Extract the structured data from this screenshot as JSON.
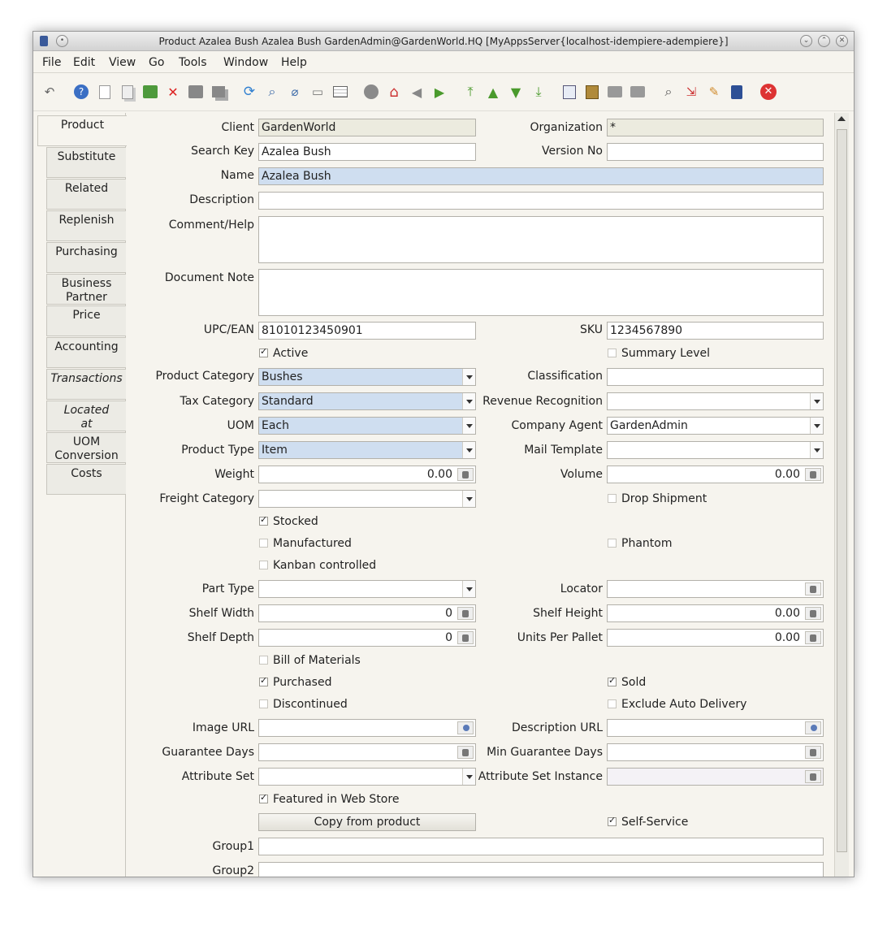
{
  "window": {
    "title": "Product  Azalea Bush  Azalea Bush  GardenAdmin@GardenWorld.HQ [MyAppsServer{localhost-idempiere-adempiere}]"
  },
  "menu": [
    "File",
    "Edit",
    "View",
    "Go",
    "Tools",
    "Window",
    "Help"
  ],
  "toolbar_icons": [
    "undo-icon",
    "help-icon",
    "new-record-icon",
    "copy-record-icon",
    "save-icon",
    "delete-icon",
    "save-grid-icon",
    "multi-record-icon",
    "refresh-icon",
    "find-icon",
    "attachment-icon",
    "chat-icon",
    "grid-toggle-icon",
    "history-icon",
    "home-icon",
    "previous-icon",
    "next-icon",
    "first-record-icon",
    "parent-record-icon",
    "child-record-icon",
    "last-record-icon",
    "report-icon",
    "archive-icon",
    "print-preview-icon",
    "print-icon",
    "zoom-across-icon",
    "workflow-icon",
    "product-info-icon",
    "calculator-icon",
    "close-window-icon"
  ],
  "tabs": [
    {
      "label": "Product",
      "selected": true
    },
    {
      "label": "Substitute"
    },
    {
      "label": "Related"
    },
    {
      "label": "Replenish"
    },
    {
      "label": "Purchasing"
    },
    {
      "label": "Business\nPartner"
    },
    {
      "label": "Price"
    },
    {
      "label": "Accounting"
    },
    {
      "label": "Transactions",
      "italic": true
    },
    {
      "label": "Located\nat",
      "italic": true
    },
    {
      "label": "UOM\nConversion"
    },
    {
      "label": "Costs"
    }
  ],
  "fields": {
    "client": {
      "label": "Client",
      "value": "GardenWorld"
    },
    "organization": {
      "label": "Organization",
      "value": "*"
    },
    "search_key": {
      "label": "Search Key",
      "value": "Azalea Bush"
    },
    "version_no": {
      "label": "Version No",
      "value": ""
    },
    "name": {
      "label": "Name",
      "value": "Azalea Bush"
    },
    "description": {
      "label": "Description",
      "value": ""
    },
    "comment_help": {
      "label": "Comment/Help",
      "value": ""
    },
    "document_note": {
      "label": "Document Note",
      "value": ""
    },
    "upc_ean": {
      "label": "UPC/EAN",
      "value": "81010123450901"
    },
    "sku": {
      "label": "SKU",
      "value": "1234567890"
    },
    "active": {
      "label": "Active",
      "checked": true
    },
    "summary_level": {
      "label": "Summary Level",
      "checked": false
    },
    "product_category": {
      "label": "Product Category",
      "value": "Bushes"
    },
    "classification": {
      "label": "Classification",
      "value": ""
    },
    "tax_category": {
      "label": "Tax Category",
      "value": "Standard"
    },
    "revenue_recognition": {
      "label": "Revenue Recognition",
      "value": ""
    },
    "uom": {
      "label": "UOM",
      "value": "Each"
    },
    "company_agent": {
      "label": "Company Agent",
      "value": "GardenAdmin"
    },
    "product_type": {
      "label": "Product Type",
      "value": "Item"
    },
    "mail_template": {
      "label": "Mail Template",
      "value": ""
    },
    "weight": {
      "label": "Weight",
      "value": "0.00"
    },
    "volume": {
      "label": "Volume",
      "value": "0.00"
    },
    "freight_category": {
      "label": "Freight Category",
      "value": ""
    },
    "drop_shipment": {
      "label": "Drop Shipment",
      "checked": false
    },
    "stocked": {
      "label": "Stocked",
      "checked": true
    },
    "manufactured": {
      "label": "Manufactured",
      "checked": false
    },
    "phantom": {
      "label": "Phantom",
      "checked": false
    },
    "kanban_controlled": {
      "label": "Kanban controlled",
      "checked": false
    },
    "part_type": {
      "label": "Part Type",
      "value": ""
    },
    "locator": {
      "label": "Locator",
      "value": ""
    },
    "shelf_width": {
      "label": "Shelf Width",
      "value": "0"
    },
    "shelf_height": {
      "label": "Shelf Height",
      "value": "0.00"
    },
    "shelf_depth": {
      "label": "Shelf Depth",
      "value": "0"
    },
    "units_per_pallet": {
      "label": "Units Per Pallet",
      "value": "0.00"
    },
    "bill_of_materials": {
      "label": "Bill of Materials",
      "checked": false
    },
    "purchased": {
      "label": "Purchased",
      "checked": true
    },
    "sold": {
      "label": "Sold",
      "checked": true
    },
    "discontinued": {
      "label": "Discontinued",
      "checked": false
    },
    "exclude_auto_delivery": {
      "label": "Exclude Auto Delivery",
      "checked": false
    },
    "image_url": {
      "label": "Image URL",
      "value": ""
    },
    "description_url": {
      "label": "Description URL",
      "value": ""
    },
    "guarantee_days": {
      "label": "Guarantee Days",
      "value": ""
    },
    "min_guarantee_days": {
      "label": "Min Guarantee Days",
      "value": ""
    },
    "attribute_set": {
      "label": "Attribute Set",
      "value": ""
    },
    "attribute_set_instance": {
      "label": "Attribute Set Instance",
      "value": ""
    },
    "featured_in_web_store": {
      "label": "Featured in Web Store",
      "checked": true
    },
    "copy_from_product": {
      "label": "Copy from product"
    },
    "self_service": {
      "label": "Self-Service",
      "checked": true
    },
    "group1": {
      "label": "Group1",
      "value": ""
    },
    "group2": {
      "label": "Group2",
      "value": ""
    }
  },
  "colors": {
    "mandatory": "#cfdef0",
    "readonly": "#ecebdf",
    "window_bg": "#f6f4ee"
  }
}
